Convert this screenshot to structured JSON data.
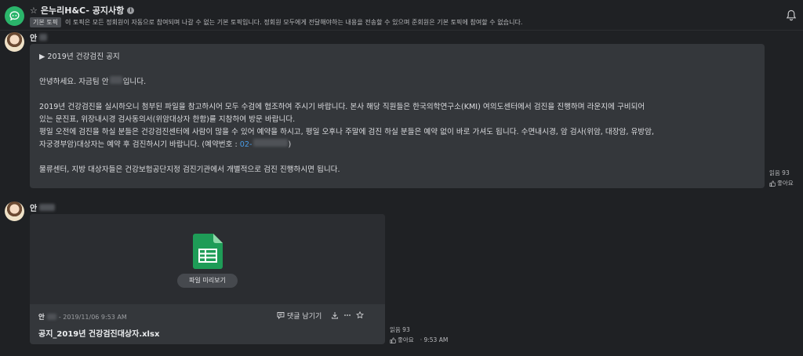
{
  "header": {
    "channel_name": "은누리H&C- 공지사항",
    "topic_badge": "기본 토픽",
    "topic_description": "이 토픽은 모든 정회원이 자동으로 참여되며 나갈 수 없는 기본 토픽입니다. 정회원 모두에게 전달해야하는 내용을 전송할 수 있으며 준회원은 기본 토픽에 참여할 수 없습니다."
  },
  "messages": [
    {
      "sender": "안",
      "lines": [
        "▶ 2019년 건강검진 공지",
        "",
        "안녕하세요. 자금팀 안",
        "입니다.",
        "",
        "2019년 건강검진을 실시하오니 첨부된 파일을 참고하시어 모두 수검에 협조하여 주시기 바랍니다. 본사 해당 직원들은 한국의학연구소(KMI) 여의도센터에서 검진을 진행하며 라운지에 구비되어",
        "있는 문진표, 위장내시경 검사동의서(위암대상자 한함)를 지참하여 방문 바랍니다.",
        "평일 오전에 검진을 하실 분들은 건강검진센터에 사람이 많을 수 있어 예약을 하시고, 평일 오후나 주말에 검진 하실 분들은 예약 없이 바로 가셔도 됩니다. 수면내시경, 암 검사(위암, 대장암, 유방암,",
        "자궁경부암)대상자는 예약 후 검진하시기 바랍니다. (예약번호 :",
        "02-",
        ")",
        "",
        "물류센터, 지방 대상자들은 건강보험공단지정 검진기관에서 개별적으로 검진 진행하시면 됩니다."
      ],
      "read_count": "읽음 93",
      "like_label": "좋아요"
    },
    {
      "sender": "안",
      "file": {
        "preview_label": "파일 미리보기",
        "sender": "안",
        "date": "- 2019/11/06 9:53 AM",
        "name": "공지_2019년 건강검진대상자.xlsx",
        "comment_label": "댓글 남기기"
      },
      "read_count": "읽음 93",
      "like_label": "좋아요",
      "time": "· 9:53 AM"
    }
  ],
  "colors": {
    "background": "#1f2124",
    "bubble": "#34373b",
    "accent_green": "#2bb56b",
    "link_blue": "#4a9ce6"
  },
  "icons": [
    "chat-channel-icon",
    "star-icon",
    "info-icon",
    "bell-icon",
    "spreadsheet-icon",
    "comment-icon",
    "download-icon",
    "more-icon",
    "bookmark-star-icon",
    "thumb-up-icon"
  ]
}
